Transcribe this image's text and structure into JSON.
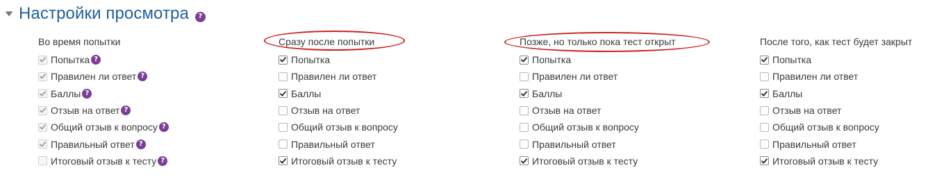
{
  "section": {
    "title": "Настройки просмотра",
    "help_icon": "question-circle-icon"
  },
  "columns": [
    {
      "key": "during",
      "heading": "Во время попытки",
      "disabled": true,
      "options": [
        {
          "label": "Попытка",
          "checked": true,
          "help": true
        },
        {
          "label": "Правилен ли ответ",
          "checked": true,
          "help": true
        },
        {
          "label": "Баллы",
          "checked": true,
          "help": true
        },
        {
          "label": "Отзыв на ответ",
          "checked": true,
          "help": true
        },
        {
          "label": "Общий отзыв к вопросу",
          "checked": true,
          "help": true
        },
        {
          "label": "Правильный ответ",
          "checked": true,
          "help": true
        },
        {
          "label": "Итоговый отзыв к тесту",
          "checked": false,
          "help": true
        }
      ]
    },
    {
      "key": "immediately",
      "heading": "Сразу после попытки",
      "disabled": false,
      "options": [
        {
          "label": "Попытка",
          "checked": true
        },
        {
          "label": "Правилен ли ответ",
          "checked": false
        },
        {
          "label": "Баллы",
          "checked": true
        },
        {
          "label": "Отзыв на ответ",
          "checked": false
        },
        {
          "label": "Общий отзыв к вопросу",
          "checked": false
        },
        {
          "label": "Правильный ответ",
          "checked": false
        },
        {
          "label": "Итоговый отзыв к тесту",
          "checked": true
        }
      ]
    },
    {
      "key": "open",
      "heading": "Позже, но только пока тест открыт",
      "disabled": false,
      "options": [
        {
          "label": "Попытка",
          "checked": true
        },
        {
          "label": "Правилен ли ответ",
          "checked": false
        },
        {
          "label": "Баллы",
          "checked": true
        },
        {
          "label": "Отзыв на ответ",
          "checked": false
        },
        {
          "label": "Общий отзыв к вопросу",
          "checked": false
        },
        {
          "label": "Правильный ответ",
          "checked": false
        },
        {
          "label": "Итоговый отзыв к тесту",
          "checked": true
        }
      ]
    },
    {
      "key": "closed",
      "heading": "После того, как тест будет закрыт",
      "disabled": false,
      "options": [
        {
          "label": "Попытка",
          "checked": true
        },
        {
          "label": "Правилен ли ответ",
          "checked": false
        },
        {
          "label": "Баллы",
          "checked": true
        },
        {
          "label": "Отзыв на ответ",
          "checked": false
        },
        {
          "label": "Общий отзыв к вопросу",
          "checked": false
        },
        {
          "label": "Правильный ответ",
          "checked": false
        },
        {
          "label": "Итоговый отзыв к тесту",
          "checked": true
        }
      ]
    }
  ],
  "annotations": {
    "circled_headings": [
      "immediately",
      "open"
    ],
    "color": "#c9211e"
  },
  "colors": {
    "title": "#1f5f9a",
    "help_icon": "#7a3e97",
    "text": "#373a3c"
  }
}
